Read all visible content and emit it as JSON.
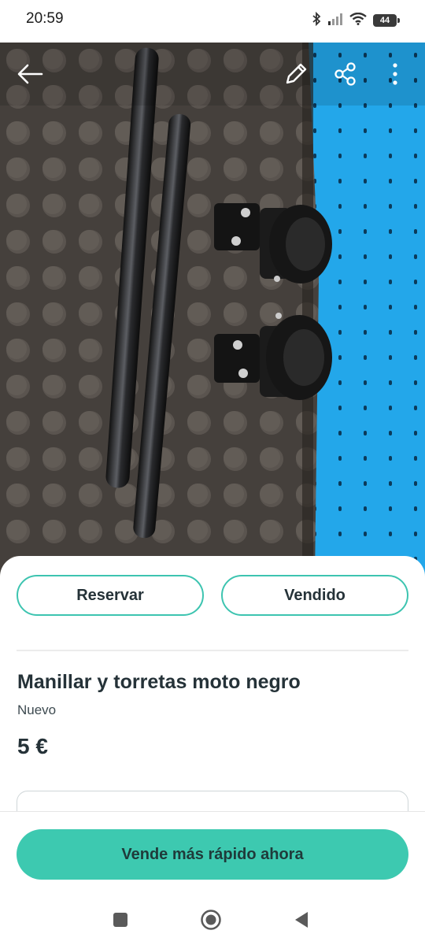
{
  "status_bar": {
    "time": "20:59",
    "battery": "44",
    "icons": [
      "bluetooth-icon",
      "signal-icon",
      "wifi-icon",
      "battery-icon"
    ]
  },
  "toolbar": {
    "icons": [
      "back-arrow-icon",
      "edit-pencil-icon",
      "share-icon",
      "more-vertical-icon"
    ]
  },
  "product": {
    "image_alt": "",
    "title": "Manillar y torretas moto negro",
    "condition": "Nuevo",
    "price": "5 €"
  },
  "actions": {
    "reserve_label": "Reservar",
    "sold_label": "Vendido"
  },
  "bottom": {
    "cta_label": "Vende más rápido ahora"
  },
  "nav": {
    "icons": [
      "recents-square-icon",
      "home-circle-icon",
      "back-triangle-icon"
    ]
  },
  "colors": {
    "accent": "#3dc9b0",
    "text": "#253238",
    "pill_border": "#3dc4b0"
  }
}
